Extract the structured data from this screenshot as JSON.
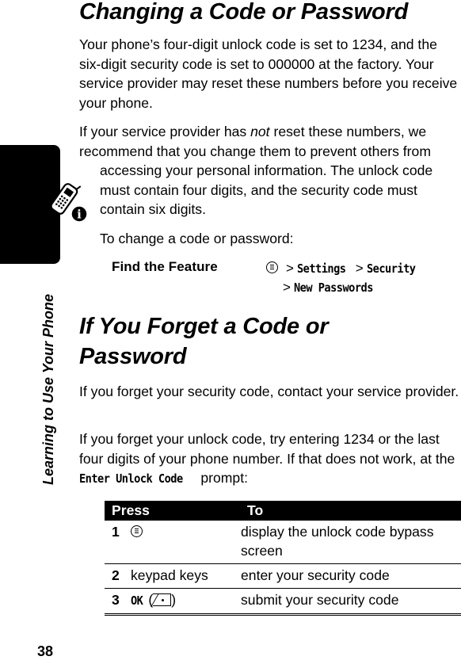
{
  "sidebar": {
    "section_label": "Learning to Use Your Phone",
    "icon": "phone-info-icon"
  },
  "page_number": "38",
  "section1": {
    "title": "Changing a Code or Password",
    "para1": "Your phone’s four-digit unlock code is set to 1234, and the six-digit security code is set to 000000 at the factory. Your service provider may reset these numbers before you receive your phone.",
    "para2_before": "If your service provider has ",
    "para2_em": "not",
    "para2_after": " reset these numbers, we recommend that you change them to prevent others from",
    "para2_indented": "accessing your personal information. The unlock code must contain four digits, and the security code must contain six digits.",
    "para3": "To change a code or password:",
    "find_feature": {
      "label": "Find the Feature",
      "icon": "menu-key-icon",
      "path": [
        "Settings",
        "Security",
        "New Passwords"
      ],
      "separator": ">"
    }
  },
  "section2": {
    "title": "If You Forget a Code or Password",
    "para1": "If you forget your security code, contact your service provider.",
    "para2_before": "If you forget your unlock code, try entering 1234 or the last four digits of your phone number. If that does not work, at the ",
    "para2_code": "Enter Unlock Code",
    "para2_after": " prompt:",
    "table": {
      "headers": [
        "Press",
        "To"
      ],
      "rows": [
        {
          "num": "1",
          "press_icon": "menu-key-icon",
          "press": "",
          "to": "display the unlock code bypass screen"
        },
        {
          "num": "2",
          "press": "keypad keys",
          "to": "enter your security code"
        },
        {
          "num": "3",
          "press": "OK",
          "press_icon": "right-soft-key-icon",
          "to": "submit your security code"
        }
      ]
    }
  }
}
